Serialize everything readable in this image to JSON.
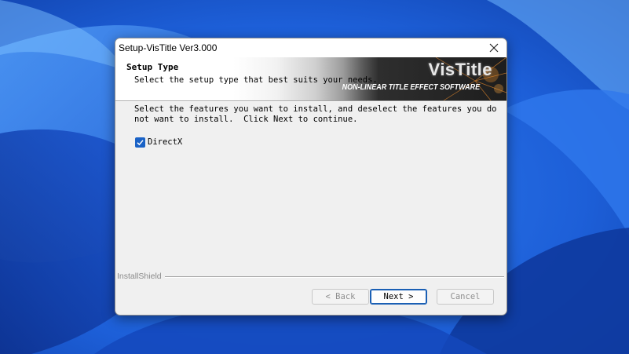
{
  "window": {
    "title": "Setup-VisTitle Ver3.000"
  },
  "header": {
    "title": "Setup Type",
    "subtitle": "Select the setup type that best suits your needs.",
    "logo_name": "VisTitle",
    "logo_tagline": "NON-LINEAR TITLE EFFECT SOFTWARE"
  },
  "body": {
    "instructions": "Select the features you want to install, and deselect the features you do\nnot want to install.  Click Next to continue.",
    "features": [
      {
        "label": "DirectX",
        "checked": true
      }
    ]
  },
  "footer": {
    "brand": "InstallShield",
    "buttons": {
      "back": "< Back",
      "next": "Next >",
      "cancel": "Cancel"
    }
  },
  "colors": {
    "accent": "#1a62c6",
    "wallpaper": "#1d5fd8",
    "dialog_bg": "#f0f0f0"
  },
  "icons": {
    "close": "close-icon",
    "check": "checkmark-icon"
  }
}
